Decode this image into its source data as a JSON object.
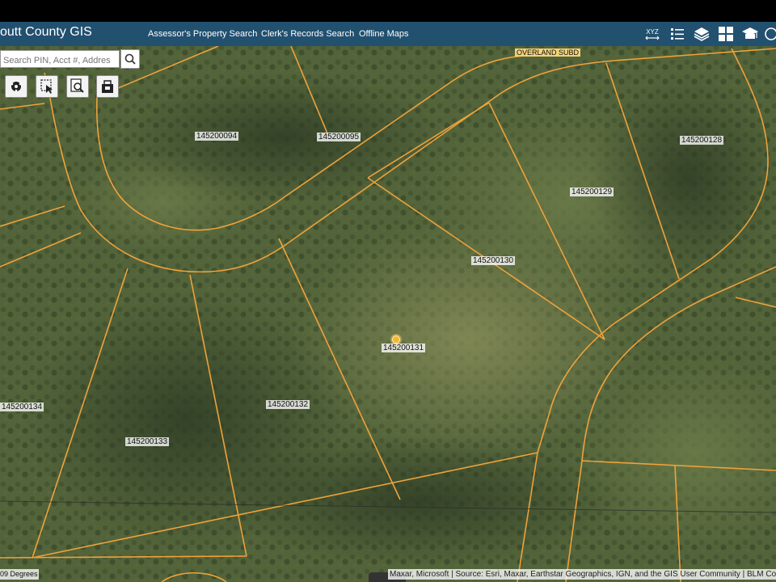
{
  "header": {
    "title": "outt County GIS",
    "links": [
      "Assessor's Property Search",
      "Clerk's Records Search",
      "Offline Maps"
    ],
    "icons": [
      "xyz-coordinates-icon",
      "legend-list-icon",
      "layers-icon",
      "basemap-gallery-icon",
      "print-icon",
      "more-icon"
    ],
    "xyz_label": "XYZ"
  },
  "search": {
    "placeholder": "Search PIN, Acct #, Addres",
    "icon": "search-icon"
  },
  "tools": [
    "identify-tool-icon",
    "select-tool-icon",
    "query-tool-icon",
    "print-bag-icon"
  ],
  "map": {
    "subdivision_label": "OVERLAND SUBD",
    "parcels": [
      "145200094",
      "145200095",
      "145200128",
      "145200129",
      "145200130",
      "145200131",
      "145200132",
      "145200133",
      "145200134"
    ],
    "location_marker": "location-pin-icon",
    "parcel_line_color": "#f0a23a",
    "scale_text": "09 Degrees",
    "attribution": "Maxar, Microsoft | Source: Esri, Maxar, Earthstar Geographics, IGN, and the GIS User Community | BLM Colo"
  },
  "colors": {
    "header_bg": "#22506f",
    "imagery_base": "#4f5f35"
  }
}
